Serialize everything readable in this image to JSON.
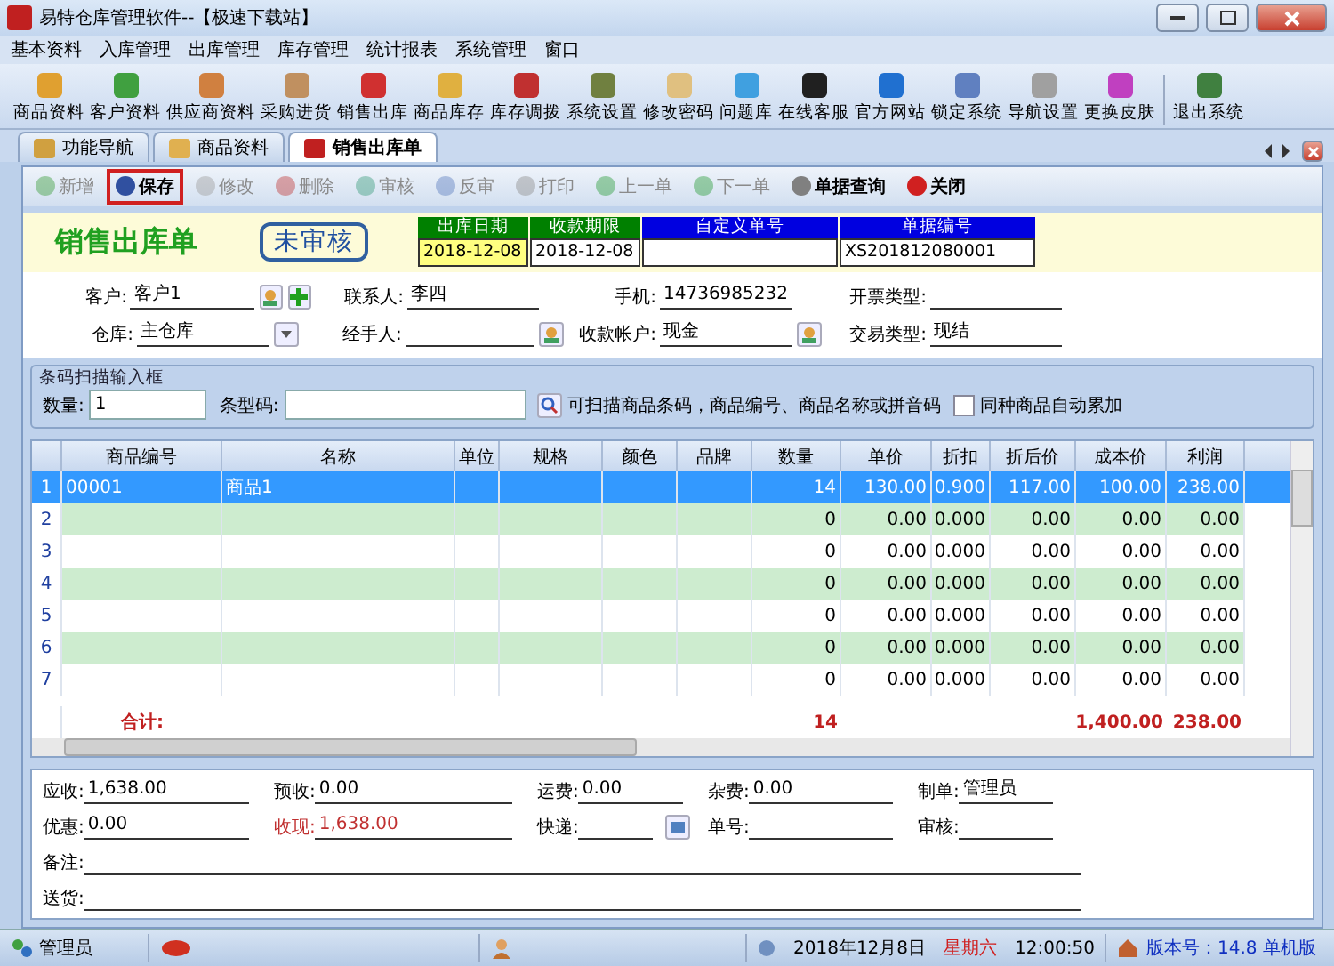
{
  "window": {
    "title": "易特仓库管理软件--【极速下载站】"
  },
  "menu": [
    "基本资料",
    "入库管理",
    "出库管理",
    "库存管理",
    "统计报表",
    "系统管理",
    "窗口"
  ],
  "toolbar": [
    "商品资料",
    "客户资料",
    "供应商资料",
    "采购进货",
    "销售出库",
    "商品库存",
    "库存调拨",
    "系统设置",
    "修改密码",
    "问题库",
    "在线客服",
    "官方网站",
    "锁定系统",
    "导航设置",
    "更换皮肤",
    "退出系统"
  ],
  "tabs": [
    {
      "label": "功能导航",
      "selected": false
    },
    {
      "label": "商品资料",
      "selected": false
    },
    {
      "label": "销售出库单",
      "selected": true
    }
  ],
  "actions": [
    {
      "label": "新增",
      "disabled": true,
      "highlighted": false
    },
    {
      "label": "保存",
      "disabled": false,
      "highlighted": true
    },
    {
      "label": "修改",
      "disabled": true,
      "highlighted": false
    },
    {
      "label": "删除",
      "disabled": true,
      "highlighted": false
    },
    {
      "label": "审核",
      "disabled": true,
      "highlighted": false
    },
    {
      "label": "反审",
      "disabled": true,
      "highlighted": false
    },
    {
      "label": "打印",
      "disabled": true,
      "highlighted": false
    },
    {
      "label": "上一单",
      "disabled": true,
      "highlighted": false
    },
    {
      "label": "下一单",
      "disabled": true,
      "highlighted": false
    },
    {
      "label": "单据查询",
      "disabled": false,
      "highlighted": false
    },
    {
      "label": "关闭",
      "disabled": false,
      "highlighted": false
    }
  ],
  "document": {
    "title": "销售出库单",
    "status": "未审核",
    "header_fields": [
      {
        "label": "出库日期",
        "value": "2018-12-08",
        "color": "#008000",
        "focused": true
      },
      {
        "label": "收款期限",
        "value": "2018-12-08",
        "color": "#008000",
        "focused": false
      },
      {
        "label": "自定义单号",
        "color": "#0000e0",
        "focused": false
      },
      {
        "label": "单据编号",
        "value": "XS201812080001",
        "color": "#0000e0",
        "focused": false
      }
    ],
    "fields": [
      {
        "label": "客户:",
        "value": "客户1",
        "lookup": true,
        "add": true
      },
      {
        "label": "联系人:",
        "value": "李四"
      },
      {
        "label": "手机:",
        "value": "14736985232"
      },
      {
        "label": "开票类型:"
      },
      {
        "label": "仓库:",
        "value": "主仓库",
        "dropdown": true
      },
      {
        "label": "经手人:",
        "lookup": true
      },
      {
        "label": "收款帐户:",
        "value": "现金",
        "lookup": true
      },
      {
        "label": "交易类型:",
        "value": "现结"
      }
    ]
  },
  "barcode": {
    "title": "条码扫描输入框",
    "quantity_label": "数量:",
    "quantity": "1",
    "code_label": "条型码:",
    "hint": "可扫描商品条码，商品编号、商品名称或拼音码",
    "accumulate": {
      "label": "同种商品自动累加",
      "checked": false
    }
  },
  "table": {
    "columns": [
      "商品编号",
      "名称",
      "单位",
      "规格",
      "颜色",
      "品牌",
      "数量",
      "单价",
      "折扣",
      "折后价",
      "成本价",
      "利润"
    ],
    "rows": [
      {
        "num": "1",
        "selected": true,
        "cells": [
          "00001",
          "商品1",
          "",
          "",
          "",
          "",
          "14",
          "130.00",
          "0.900",
          "117.00",
          "100.00",
          "238.00"
        ]
      },
      {
        "num": "2",
        "selected": false,
        "cells": [
          "",
          "",
          "",
          "",
          "",
          "",
          "0",
          "0.00",
          "0.000",
          "0.00",
          "0.00",
          "0.00"
        ]
      },
      {
        "num": "3",
        "selected": false,
        "cells": [
          "",
          "",
          "",
          "",
          "",
          "",
          "0",
          "0.00",
          "0.000",
          "0.00",
          "0.00",
          "0.00"
        ]
      },
      {
        "num": "4",
        "selected": false,
        "cells": [
          "",
          "",
          "",
          "",
          "",
          "",
          "0",
          "0.00",
          "0.000",
          "0.00",
          "0.00",
          "0.00"
        ]
      },
      {
        "num": "5",
        "selected": false,
        "cells": [
          "",
          "",
          "",
          "",
          "",
          "",
          "0",
          "0.00",
          "0.000",
          "0.00",
          "0.00",
          "0.00"
        ]
      },
      {
        "num": "6",
        "selected": false,
        "cells": [
          "",
          "",
          "",
          "",
          "",
          "",
          "0",
          "0.00",
          "0.000",
          "0.00",
          "0.00",
          "0.00"
        ]
      },
      {
        "num": "7",
        "selected": false,
        "cells": [
          "",
          "",
          "",
          "",
          "",
          "",
          "0",
          "0.00",
          "0.000",
          "0.00",
          "0.00",
          "0.00"
        ]
      }
    ],
    "totals": {
      "label": "合计:",
      "cells": [
        "",
        "",
        "",
        "",
        "",
        "",
        "14",
        "",
        "",
        "",
        "1,400.00",
        "238.00"
      ]
    }
  },
  "footer": {
    "rows": [
      [
        {
          "label": "应收:",
          "value": "1,638.00"
        },
        {
          "label": "预收:",
          "value": "0.00"
        },
        {
          "label": "运费:",
          "value": "0.00"
        },
        {
          "label": "杂费:",
          "value": "0.00"
        },
        {
          "label": "制单:",
          "value": "管理员"
        }
      ],
      [
        {
          "label": "优惠:",
          "value": "0.00"
        },
        {
          "label": "收现:",
          "value": "1,638.00",
          "emphasis": true
        },
        {
          "label": "快递:",
          "button": true
        },
        {
          "label": "单号:"
        },
        {
          "label": "审核:"
        }
      ]
    ],
    "long_fields": [
      {
        "label": "备注:"
      },
      {
        "label": "送货:"
      }
    ]
  },
  "status_bar": {
    "user": "管理员",
    "date": "2018年12月8日",
    "weekday": "星期六",
    "time": "12:00:50",
    "version": "版本号：14.8 单机版"
  }
}
